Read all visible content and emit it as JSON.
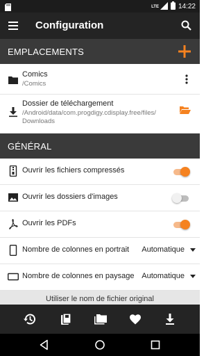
{
  "status_bar": {
    "network": "LTE",
    "time": "14:22"
  },
  "app_bar": {
    "title": "Configuration",
    "menu_icon": "menu-icon",
    "search_icon": "search-icon"
  },
  "locations": {
    "header": "EMPLACEMENTS",
    "add_icon": "plus-icon",
    "items": [
      {
        "title": "Comics",
        "path": "/Comics",
        "icon": "folder-icon",
        "action_icon": "more-vert-icon"
      },
      {
        "title": "Dossier de téléchargement",
        "path": "/Android/data/com.progdigy.cdisplay.free/files/\nDownloads",
        "icon": "download-icon",
        "action_icon": "folder-open-icon"
      }
    ]
  },
  "general": {
    "header": "GÉNÉRAL",
    "toggles": [
      {
        "label": "Ouvrir les fichiers compressés",
        "icon": "archive-icon",
        "on": true
      },
      {
        "label": "Ouvrir les dossiers d'images",
        "icon": "image-icon",
        "on": false
      },
      {
        "label": "Ouvrir les PDFs",
        "icon": "pdf-icon",
        "on": true
      }
    ],
    "selects": [
      {
        "label": "Nombre de colonnes en portrait",
        "icon": "phone-portrait-icon",
        "value": "Automatique"
      },
      {
        "label": "Nombre de colonnes en paysage",
        "icon": "phone-landscape-icon",
        "value": "Automatique"
      }
    ],
    "partial_item": "Utiliser le nom de fichier original"
  },
  "bottom_nav": [
    "history-icon",
    "library-icon",
    "folders-icon",
    "favorites-icon",
    "downloads-icon"
  ],
  "system_nav": [
    "back-icon",
    "home-icon",
    "recents-icon"
  ],
  "colors": {
    "accent": "#f58220",
    "app_bar": "#242424",
    "section_header": "#3a3a3a",
    "status_bar": "#1c1c1c"
  }
}
